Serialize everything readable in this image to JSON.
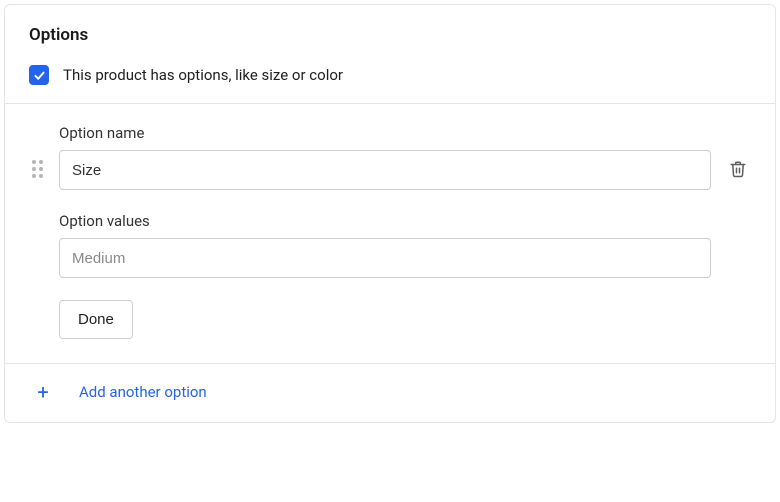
{
  "card": {
    "title": "Options",
    "checkbox": {
      "checked": true,
      "label": "This product has options, like size or color"
    }
  },
  "option": {
    "name_label": "Option name",
    "name_value": "Size",
    "values_label": "Option values",
    "values_placeholder": "Medium",
    "done_label": "Done"
  },
  "add": {
    "label": "Add another option"
  }
}
